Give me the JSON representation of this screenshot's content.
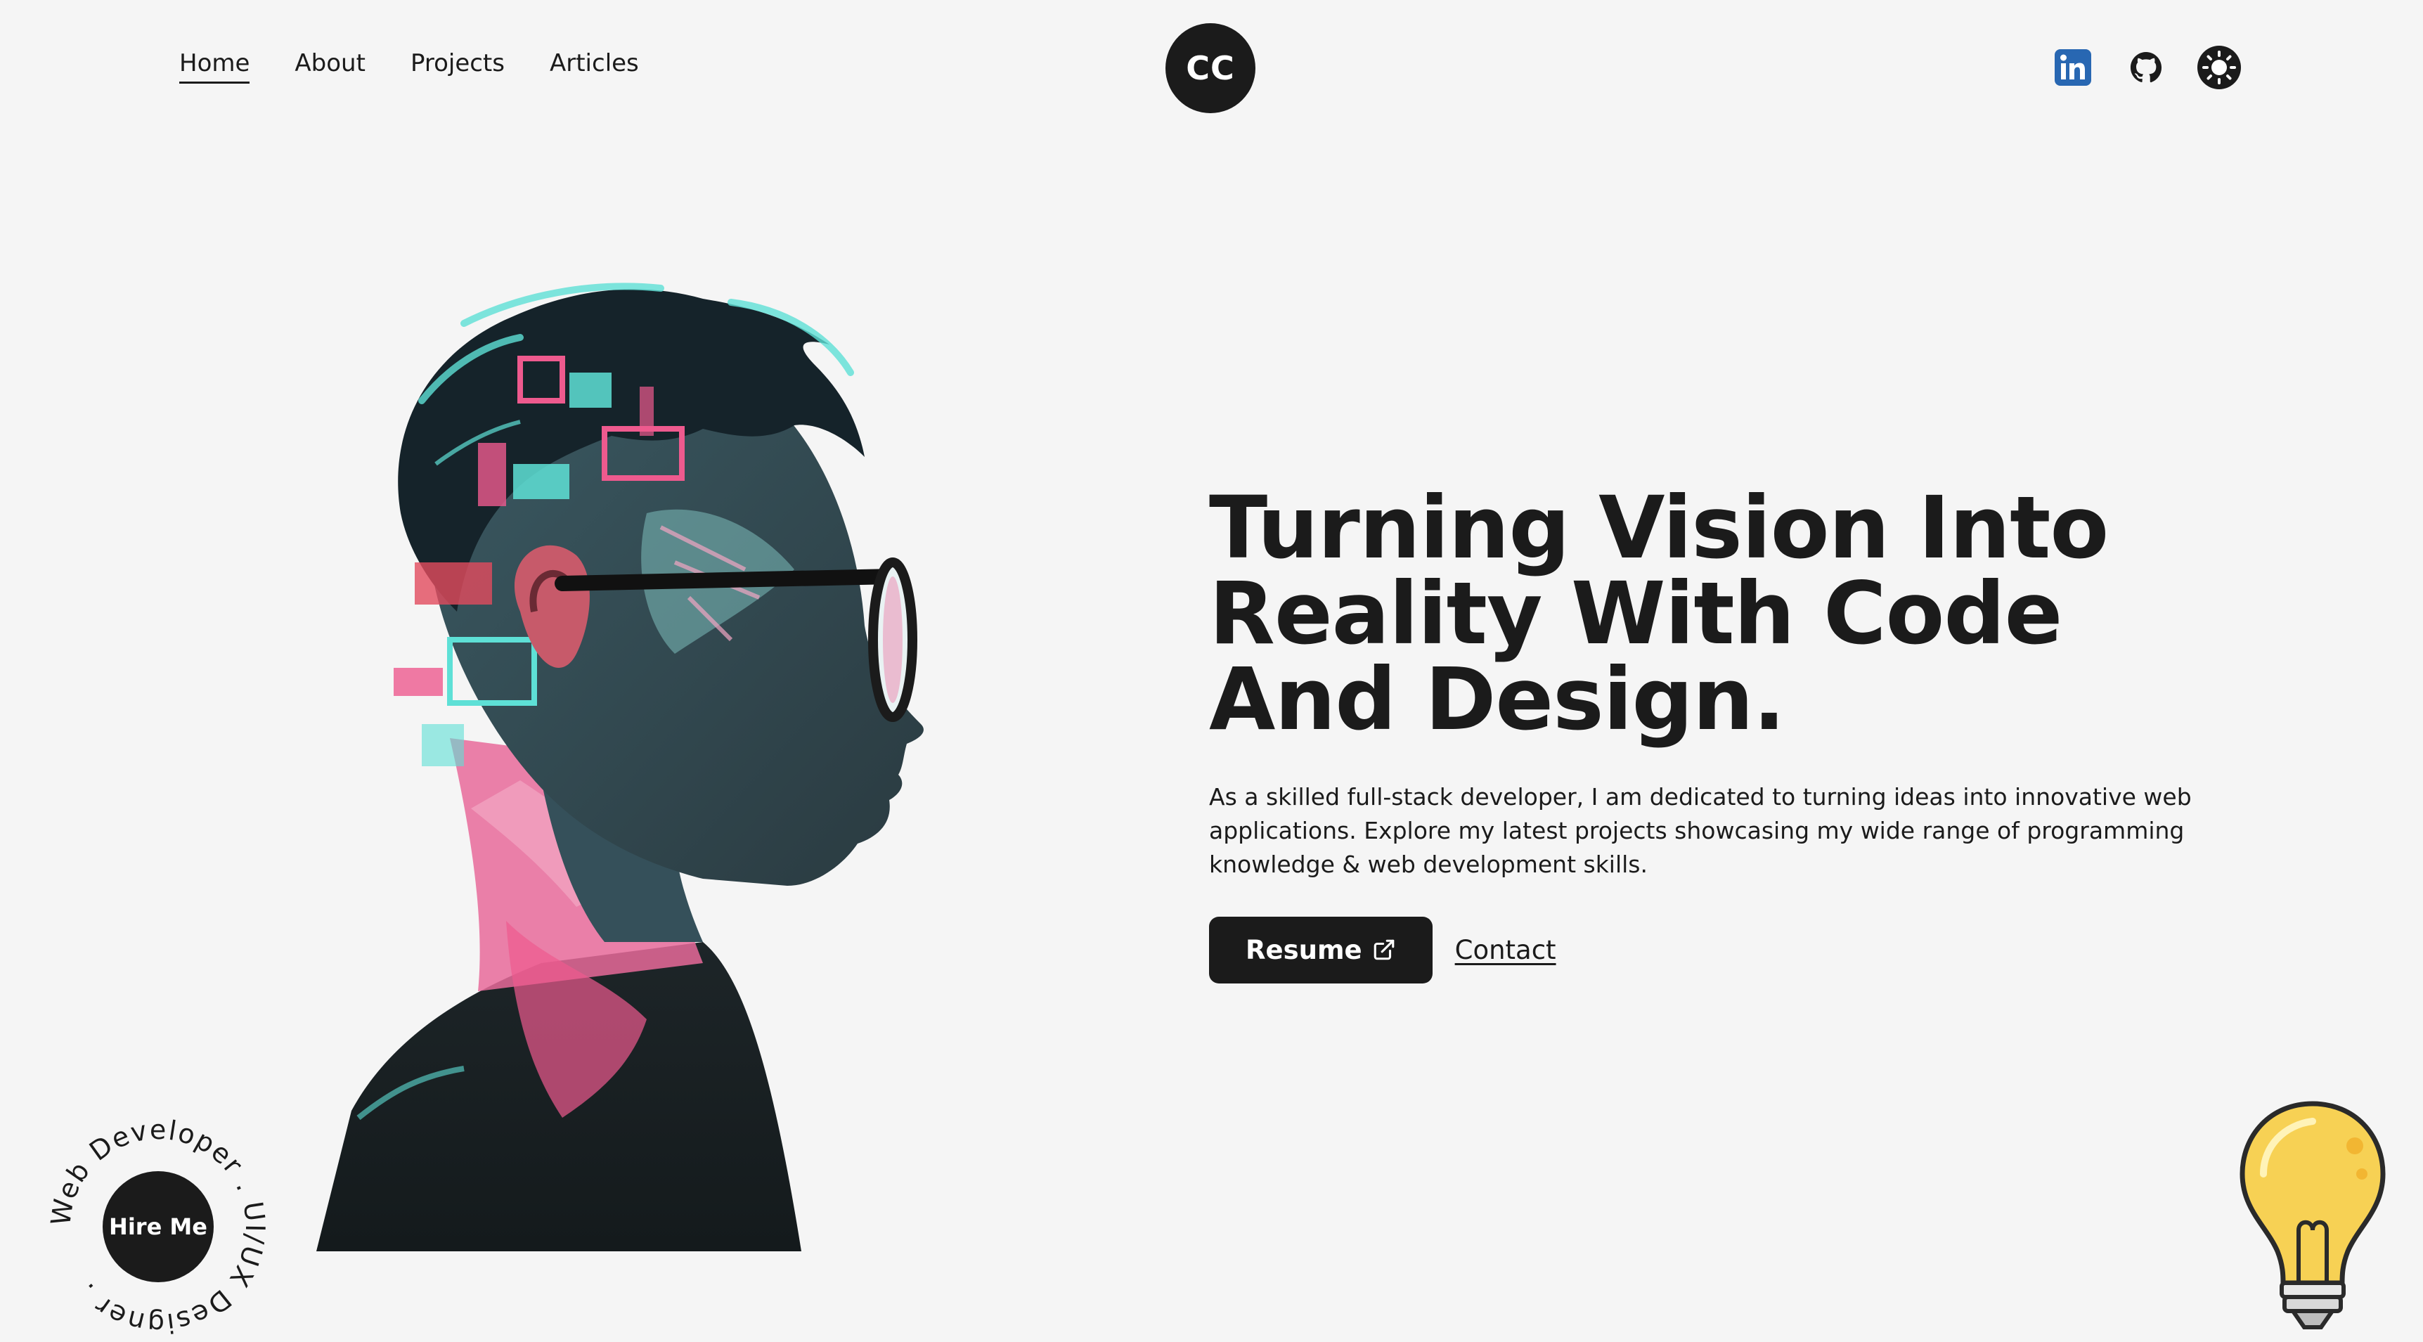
{
  "nav": {
    "links": [
      {
        "label": "Home",
        "active": true
      },
      {
        "label": "About",
        "active": false
      },
      {
        "label": "Projects",
        "active": false
      },
      {
        "label": "Articles",
        "active": false
      }
    ],
    "logo_text": "CC",
    "socials": [
      {
        "icon": "linkedin-icon"
      },
      {
        "icon": "github-icon"
      },
      {
        "icon": "sun-theme-toggle-icon"
      }
    ]
  },
  "hero": {
    "headline": "Turning Vision Into Reality With Code And Design.",
    "description": "As a skilled full-stack developer, I am dedicated to turning ideas into innovative web applications. Explore my latest projects showcasing my wide range of programming knowledge & web development skills.",
    "resume_label": "Resume",
    "contact_label": "Contact"
  },
  "hire": {
    "button_label": "Hire Me",
    "ring_text": "Web Developer . UI/UX Designer . "
  },
  "colors": {
    "background": "#f5f5f5",
    "dark": "#1b1b1b",
    "accent_cyan": "#5ee0d6",
    "accent_pink": "#ee5a8e",
    "linkedin_blue": "#2867b2",
    "bulb_yellow": "#f7d154"
  }
}
